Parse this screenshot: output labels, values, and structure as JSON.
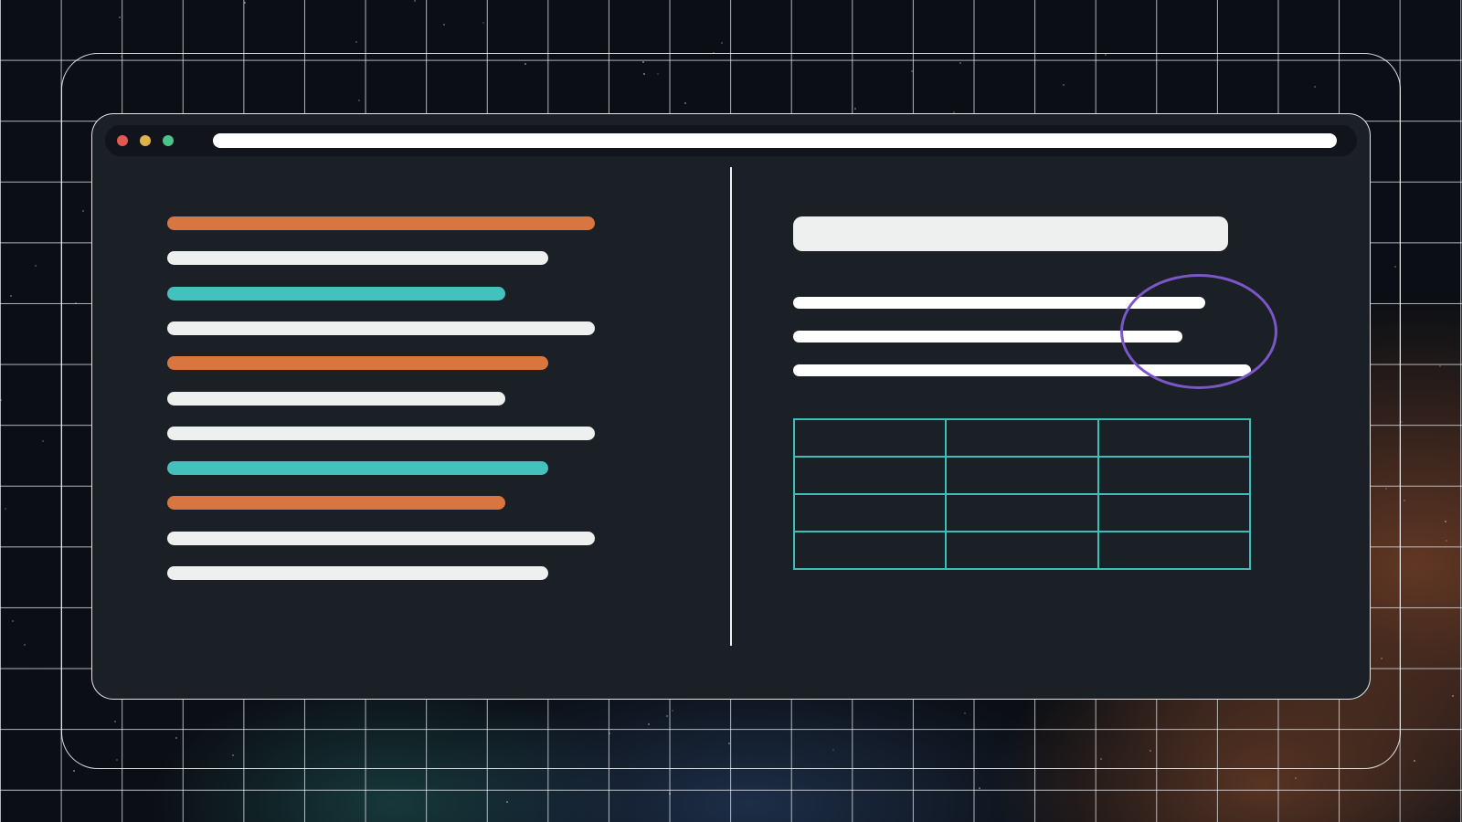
{
  "colors": {
    "background": "#0b0f15",
    "window": "#1b1f26",
    "accent_orange": "#d9753f",
    "accent_teal": "#45c1bd",
    "line_white": "#eef0f0",
    "highlight_purple": "#7b56c8",
    "table_border": "#3fbdb7"
  },
  "window": {
    "controls": [
      "close-dot",
      "minimize-dot",
      "maximize-dot"
    ]
  },
  "left_pane": {
    "code_lines": [
      {
        "color": "orange",
        "length": 1.0
      },
      {
        "color": "white",
        "length": 0.89
      },
      {
        "color": "teal",
        "length": 0.79
      },
      {
        "color": "white",
        "length": 1.0
      },
      {
        "color": "orange",
        "length": 0.89
      },
      {
        "color": "white",
        "length": 0.79
      },
      {
        "color": "white",
        "length": 1.0
      },
      {
        "color": "teal",
        "length": 0.89
      },
      {
        "color": "orange",
        "length": 0.79
      },
      {
        "color": "white",
        "length": 1.0
      },
      {
        "color": "white",
        "length": 0.89
      }
    ]
  },
  "right_pane": {
    "text_lines": 3,
    "highlighted": "line-ends",
    "table": {
      "rows": 4,
      "columns": 3
    }
  }
}
